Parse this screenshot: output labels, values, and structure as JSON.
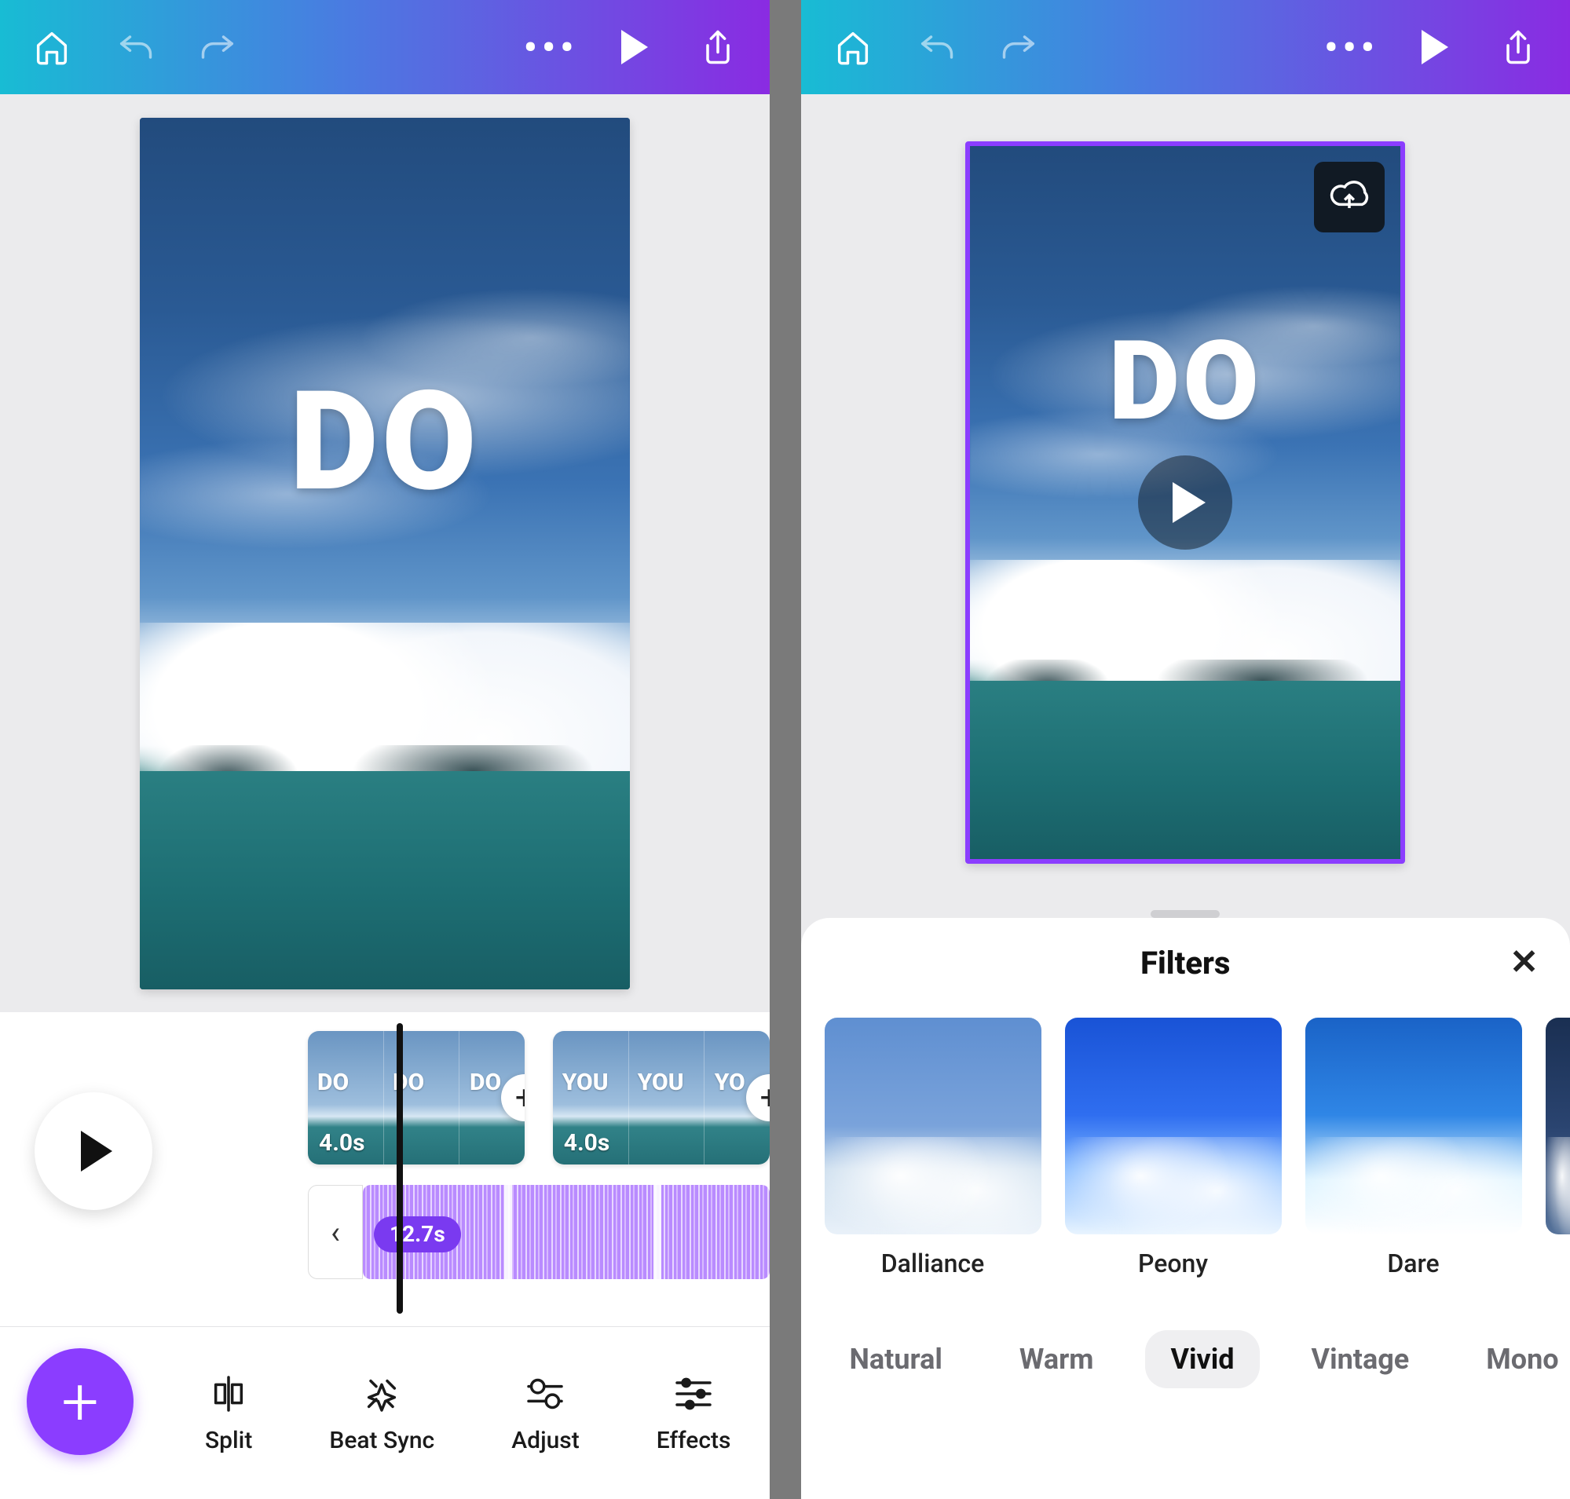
{
  "left": {
    "canvas_text": "DO",
    "timeline": {
      "clip1": {
        "labels": [
          "DO",
          "DO",
          "DO"
        ],
        "duration": "4.0s"
      },
      "clip2": {
        "labels": [
          "YOU",
          "YOU",
          "YO"
        ],
        "duration": "4.0s"
      },
      "audio_duration": "12.7s",
      "prev_chevron": "‹"
    },
    "tools": {
      "split": "Split",
      "beatsync": "Beat Sync",
      "adjust": "Adjust",
      "effects": "Effects"
    }
  },
  "right": {
    "canvas_text": "DO",
    "filters_title": "Filters",
    "close": "✕",
    "swatches": [
      {
        "name": "Dalliance",
        "cls": "dalliance"
      },
      {
        "name": "Peony",
        "cls": "peony"
      },
      {
        "name": "Dare",
        "cls": "dare"
      }
    ],
    "categories": [
      "Natural",
      "Warm",
      "Vivid",
      "Vintage",
      "Mono"
    ],
    "active_category": "Vivid"
  }
}
